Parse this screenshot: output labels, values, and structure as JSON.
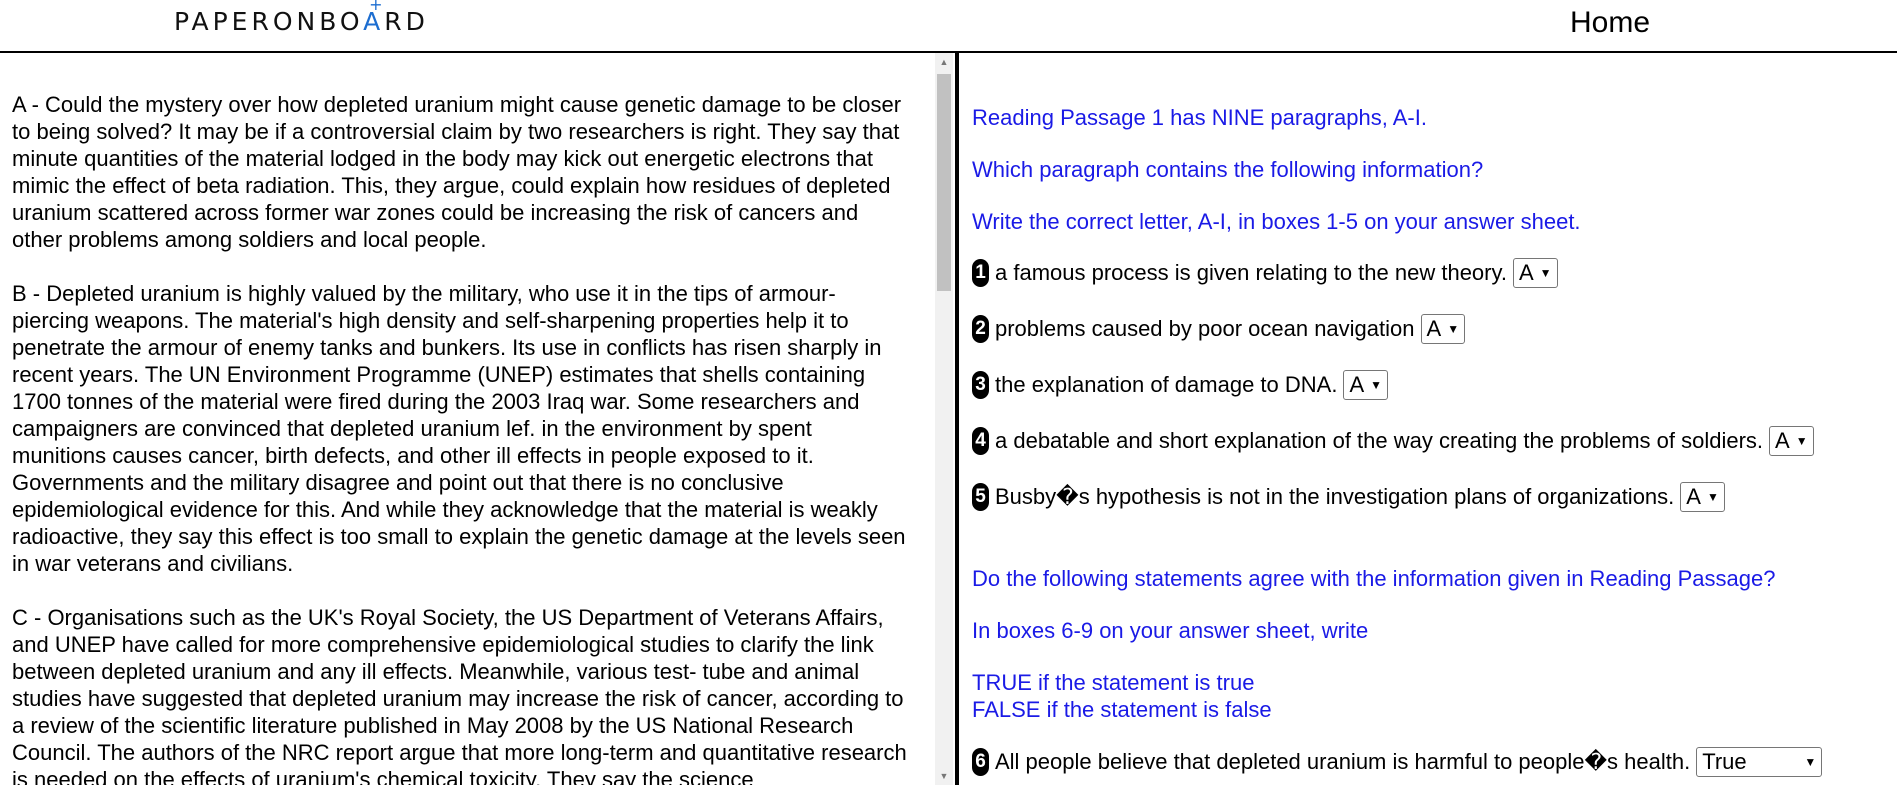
{
  "header": {
    "logo_left": "PAPERONBO",
    "logo_mark": "+",
    "logo_a": "A",
    "logo_right": "RD",
    "home_label": "Home"
  },
  "passage": {
    "paragraphs": [
      " A - Could the mystery over how depleted uranium might cause genetic damage to be closer to being solved? It may be if a controversial claim by two researchers is right. They say that minute quantities of the material lodged in the body may kick out energetic electrons that mimic the effect of beta radiation. This, they argue, could explain how residues of depleted uranium scattered across former war zones could be increasing the risk of cancers and other problems among soldiers and local people.",
      "B - Depleted uranium is highly valued by the military, who use it in the tips of armour-piercing weapons. The material's high density and self-sharpening properties help it to penetrate the armour of enemy tanks and bunkers. Its use in conflicts has risen sharply in recent years. The UN Environment Programme (UNEP) estimates that shells containing 1700 tonnes of the material were fired during the 2003 Iraq war. Some researchers and campaigners are convinced that depleted uranium lef. in the environment by spent munitions causes cancer, birth defects, and other ill effects in people exposed to it. Governments and the military disagree and point out that there is no conclusive epidemiological evidence for this. And while they acknowledge that the material is weakly radioactive, they say this effect is too small to explain the genetic damage at the levels seen in war veterans and civilians.",
      "C - Organisations such as the UK's Royal Society, the US Department of Veterans Affairs, and UNEP have called for more comprehensive epidemiological studies to clarify the link between depleted uranium and any ill effects. Meanwhile, various test- tube and animal studies have suggested that depleted uranium may increase the risk of cancer, according to a review of the scientific literature published in May 2008 by the US National Research Council. The authors of the NRC report argue that more long-term and quantitative research is needed on the effects of uranium's chemical toxicity. They say the science"
    ]
  },
  "questions": {
    "intro1": "Reading Passage 1 has NINE paragraphs, A-I.",
    "intro2": "Which paragraph contains the following information?",
    "intro3": "Write the correct letter, A-I, in boxes 1-5 on your answer sheet.",
    "items": [
      {
        "num": "1",
        "text": "a famous process is given relating to the new theory.",
        "answer": "A"
      },
      {
        "num": "2",
        "text": "problems caused by poor ocean navigation",
        "answer": "A"
      },
      {
        "num": "3",
        "text": "the explanation of damage to DNA.",
        "answer": "A"
      },
      {
        "num": "4",
        "text": "a debatable and short explanation of the way creating the problems of soldiers.",
        "answer": "A"
      },
      {
        "num": "5",
        "text": "Busby�s hypothesis is not in the investigation plans of organizations.",
        "answer": "A"
      }
    ],
    "tf_intro1": "Do the following statements agree with the information given in Reading Passage?",
    "tf_intro2": "In boxes 6-9 on your answer sheet, write",
    "tf_true": "TRUE if the statement is true",
    "tf_false": "FALSE if the statement is false",
    "q6": {
      "num": "6",
      "text": "All people believe that depleted uranium is harmful to people�s health.",
      "answer": "True"
    }
  },
  "colors": {
    "instruction": "#1a1ae6",
    "logo_accent": "#1c6dd0"
  }
}
